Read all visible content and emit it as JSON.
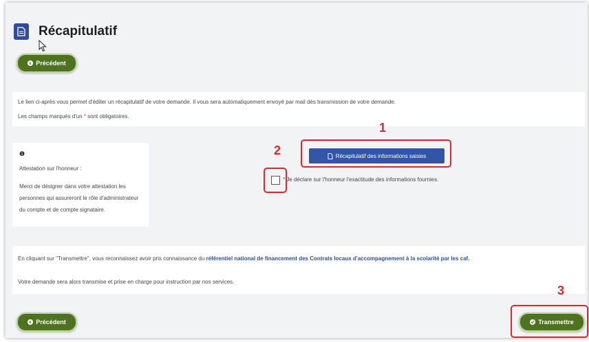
{
  "header": {
    "title": "Récapitulatif",
    "icon": "document-icon"
  },
  "nav": {
    "previous_label": "Précédent",
    "submit_label": "Transmettre"
  },
  "intro": {
    "line1": "Le lien ci-après vous permet d'éditer un récapitulatif de votre demande. Il vous sera automatiquement envoyé par mail dès transmission de votre demande.",
    "required_prefix": "Les champs marqués d'un ",
    "required_star": "*",
    "required_suffix": " sont obligatoires."
  },
  "attestation": {
    "info_icon": "❶",
    "heading": "Attestation sur l'honneur :",
    "text": "Merci de désigner dans votre attestation les personnes qui assureront le rôle d'administrateur du compte et de compte signataire."
  },
  "summary_button": {
    "label": "Récapitulatif des informations saisies"
  },
  "declaration": {
    "star": "*",
    "text": " Je déclare sur l'honneur l'exactitude des informations fournies.",
    "checked": false
  },
  "transmit": {
    "prefix": "En cliquant sur \"Transmettre\", vous reconnaissez avoir pris connaissance du ",
    "link": "référentiel national de financement des Contrats locaux d'accompagnement à la scolarité par les caf.",
    "line2": "Votre demande sera alors transmise et prise en charge pour instruction par nos services."
  },
  "annotations": {
    "n1": "1",
    "n2": "2",
    "n3": "3"
  },
  "colors": {
    "green": "#4f7221",
    "blue": "#3255a8",
    "highlight": "#e0262b"
  }
}
